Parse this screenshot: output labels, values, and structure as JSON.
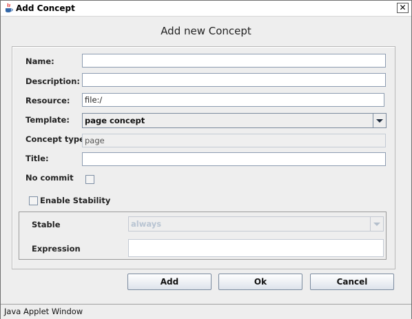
{
  "window": {
    "title": "Add Concept",
    "close_glyph": "✕",
    "icon": "java-icon"
  },
  "header": {
    "title": "Add new Concept"
  },
  "form": {
    "name": {
      "label": "Name:",
      "value": ""
    },
    "description": {
      "label": "Description:",
      "value": ""
    },
    "resource": {
      "label": "Resource:",
      "value": "file:/"
    },
    "template": {
      "label": "Template:",
      "value": "page concept"
    },
    "concept_type": {
      "label": "Concept type:",
      "value": "page"
    },
    "title": {
      "label": "Title:",
      "value": ""
    },
    "no_commit": {
      "label": "No commit",
      "checked": false
    },
    "enable_stability": {
      "label": "Enable Stability",
      "checked": false
    },
    "stable": {
      "label": "Stable",
      "value": "always"
    },
    "expression": {
      "label": "Expression",
      "value": ""
    }
  },
  "buttons": {
    "add": "Add",
    "ok": "Ok",
    "cancel": "Cancel"
  },
  "status": {
    "text": "Java Applet Window"
  },
  "colors": {
    "window_bg": "#eeeeee",
    "field_border": "#8b9bb0",
    "disabled_text": "#b8c4d2"
  }
}
